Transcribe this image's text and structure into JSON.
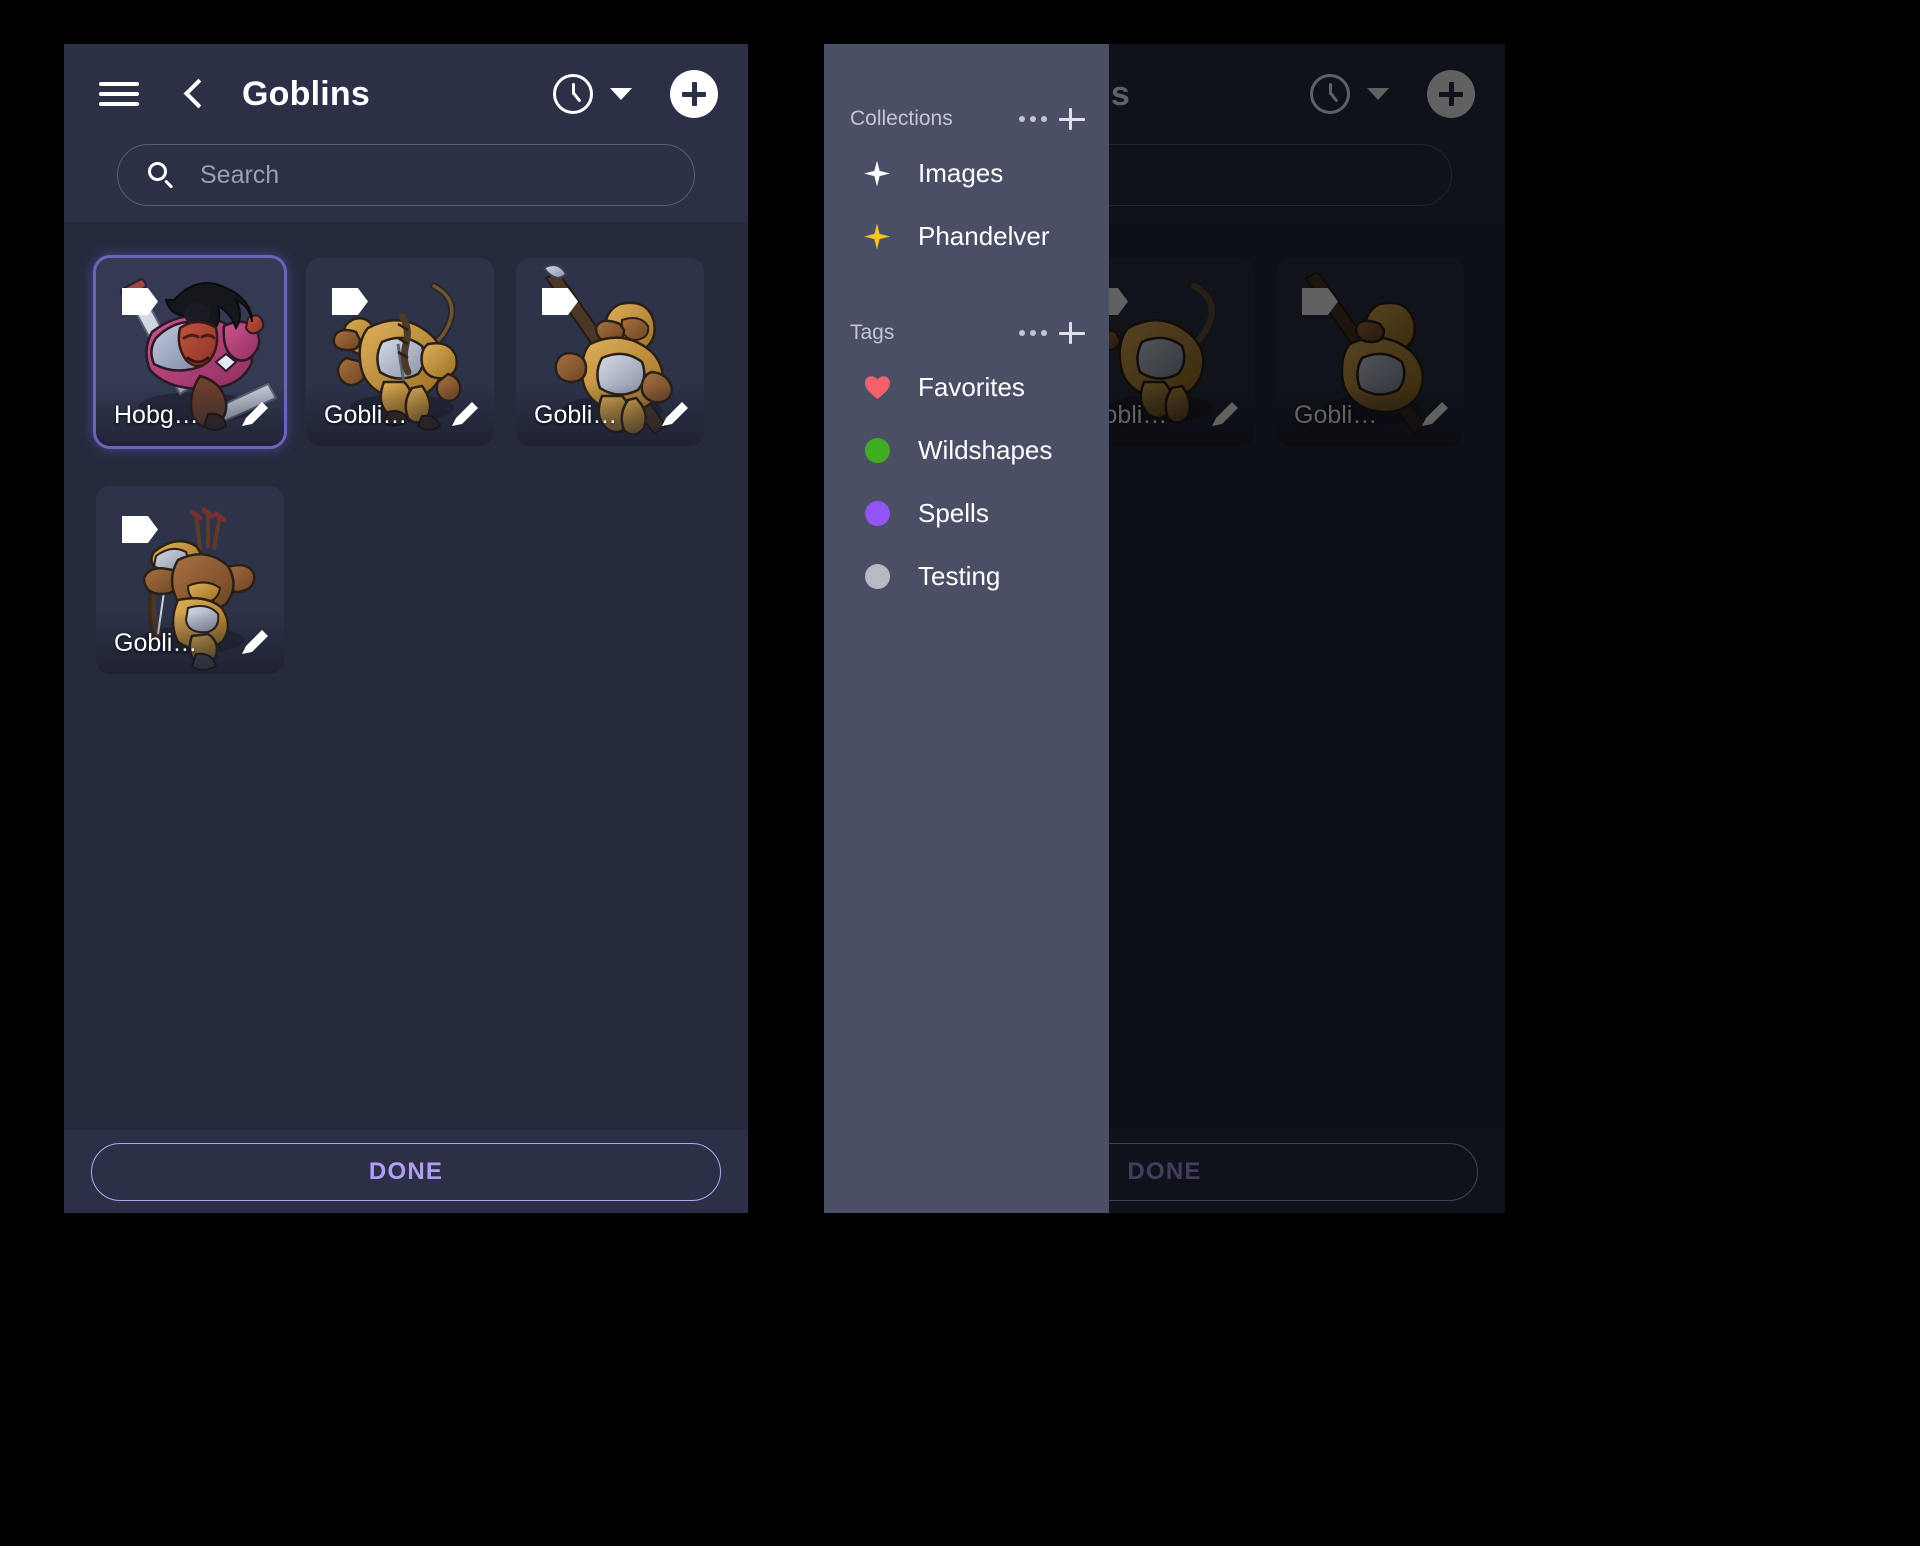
{
  "app": {
    "title": "Goblins",
    "menu_icon": "hamburger-icon",
    "back_icon": "back-chevron-icon",
    "history_icon": "clock-icon",
    "history_caret_icon": "caret-down-icon",
    "add_icon": "plus-icon"
  },
  "search": {
    "placeholder": "Search",
    "value": "",
    "icon": "search-icon"
  },
  "tokens": [
    {
      "label": "Hobg…",
      "full_name": "Hobgoblin",
      "selected": true,
      "art": "hobgoblin",
      "edit_icon": "pencil-icon",
      "tag_icon": "tag-badge-icon"
    },
    {
      "label": "Gobli…",
      "full_name": "Goblin",
      "selected": false,
      "art": "goblin-scimitar",
      "edit_icon": "pencil-icon",
      "tag_icon": "tag-badge-icon"
    },
    {
      "label": "Gobli…",
      "full_name": "Goblin",
      "selected": false,
      "art": "goblin-spear",
      "edit_icon": "pencil-icon",
      "tag_icon": "tag-badge-icon"
    },
    {
      "label": "Gobli…",
      "full_name": "Goblin",
      "selected": false,
      "art": "goblin-archer",
      "edit_icon": "pencil-icon",
      "tag_icon": "tag-badge-icon"
    }
  ],
  "footer": {
    "done_label": "DONE"
  },
  "drawer": {
    "collections": {
      "title": "Collections",
      "more_icon": "more-dots-icon",
      "add_icon": "plus-icon",
      "items": [
        {
          "label": "Images",
          "icon": "star-icon",
          "color": "#ffffff"
        },
        {
          "label": "Phandelver",
          "icon": "star-icon",
          "color": "#f5c425"
        }
      ]
    },
    "tags": {
      "title": "Tags",
      "more_icon": "more-dots-icon",
      "add_icon": "plus-icon",
      "items": [
        {
          "label": "Favorites",
          "icon": "heart-icon",
          "color": "#f4616a"
        },
        {
          "label": "Wildshapes",
          "icon": "dot-icon",
          "color": "#3fac22"
        },
        {
          "label": "Spells",
          "icon": "dot-icon",
          "color": "#9355f7"
        },
        {
          "label": "Testing",
          "icon": "dot-icon",
          "color": "#b7bac4"
        }
      ]
    }
  },
  "theme": {
    "background": "#000000",
    "surface": "#252a3d",
    "appbar": "#2b3047",
    "card": "#2d3349",
    "drawer": "#4a4f66",
    "accent": "#b39ef5",
    "selection": "#6d63b8"
  }
}
